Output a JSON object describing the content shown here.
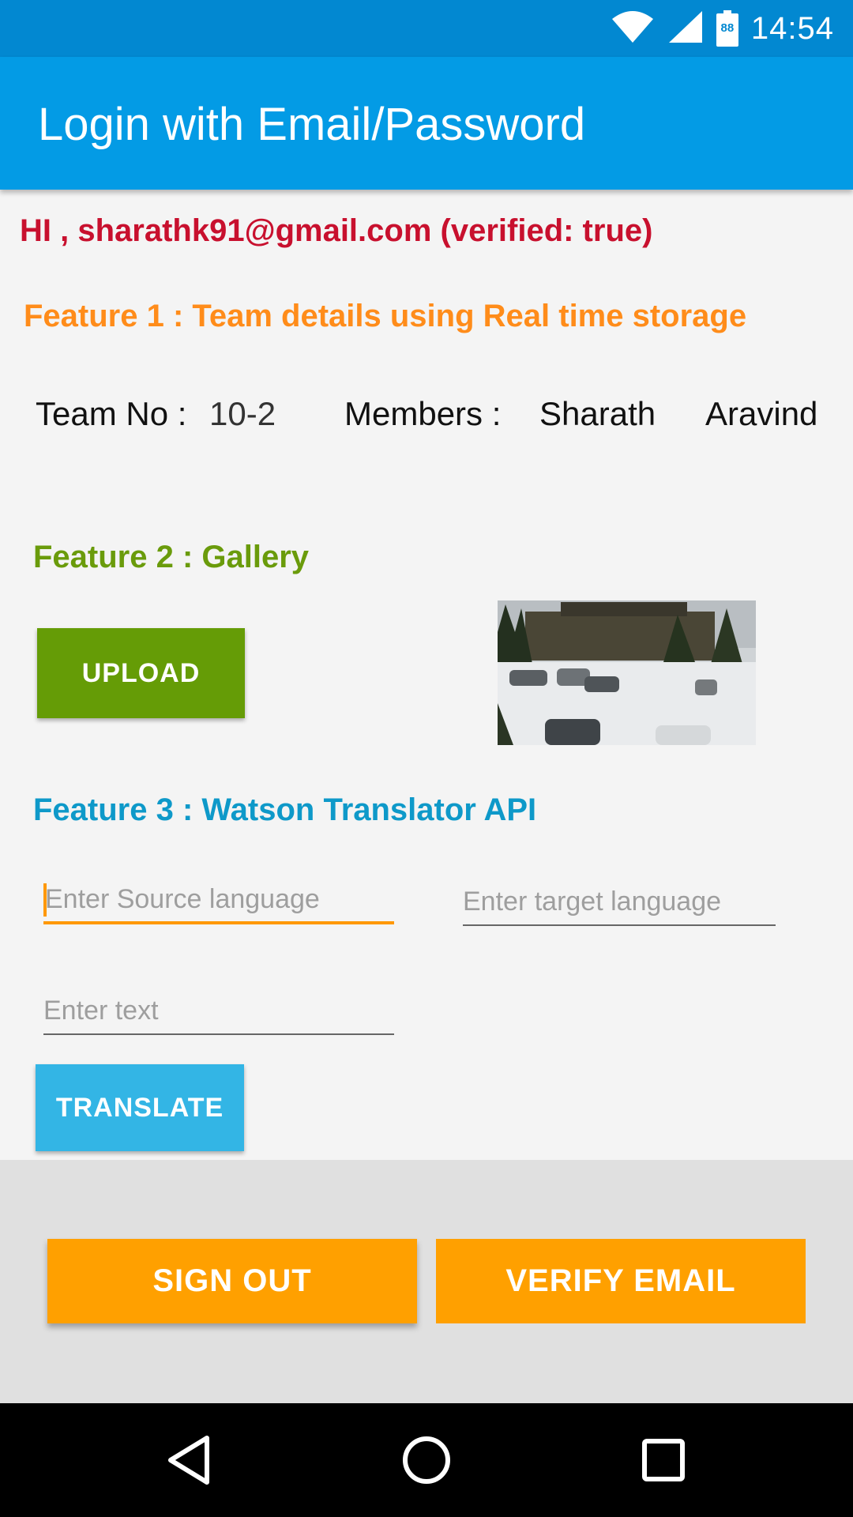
{
  "status_bar": {
    "time": "14:54",
    "battery_level": "88",
    "icons": [
      "wifi-icon",
      "cell-signal-icon",
      "battery-icon"
    ]
  },
  "app_bar": {
    "title": "Login with Email/Password"
  },
  "greeting": "HI , sharathk91@gmail.com (verified: true)",
  "feature1": {
    "title": "Feature 1 : Team details using Real time storage",
    "team_label": "Team No :",
    "team_value": "10-2",
    "members_label": "Members :",
    "members": [
      "Sharath",
      "Aravind"
    ]
  },
  "feature2": {
    "title": "Feature 2 : Gallery",
    "upload_label": "UPLOAD"
  },
  "feature3": {
    "title": "Feature 3 : Watson Translator API",
    "source_placeholder": "Enter Source language",
    "source_value": "",
    "target_placeholder": "Enter target language",
    "target_value": "",
    "text_placeholder": "Enter text",
    "text_value": "",
    "translate_label": "TRANSLATE"
  },
  "actions": {
    "sign_out_label": "SIGN OUT",
    "verify_email_label": "VERIFY EMAIL"
  },
  "nav_bar": [
    "back-icon",
    "home-icon",
    "recents-icon"
  ],
  "colors": {
    "status_bar": "#0288d1",
    "app_bar": "#039be5",
    "greeting": "#c8102e",
    "feature1": "#ff8c1a",
    "feature2": "#6a9b0b",
    "feature3": "#0e99c9",
    "upload": "#659c06",
    "translate": "#33b5e5",
    "action_buttons": "#ffa000"
  }
}
